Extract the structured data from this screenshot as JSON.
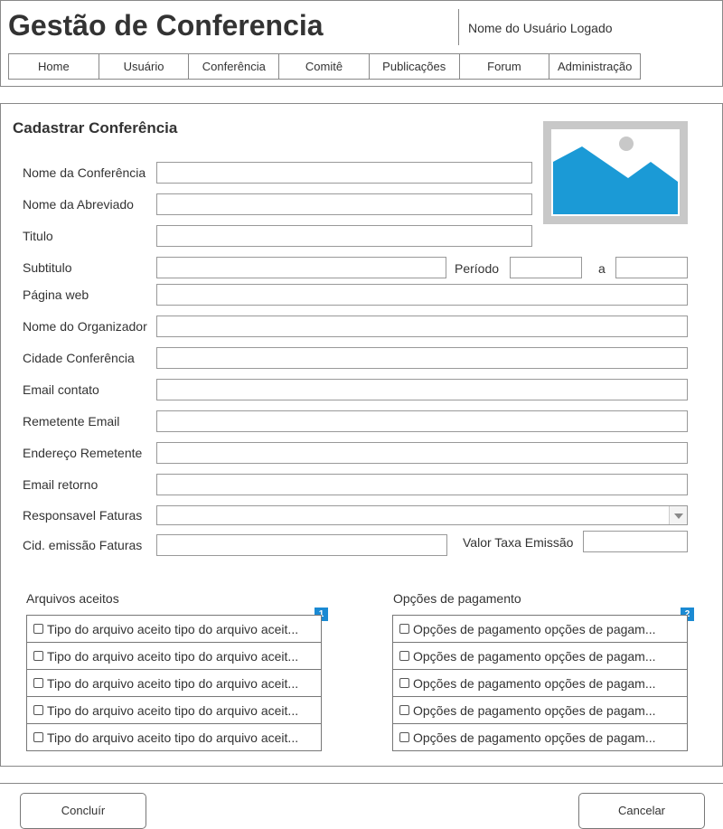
{
  "header": {
    "title": "Gestão de Conferencia",
    "user_name": "Nome do Usuário Logado",
    "nav": [
      "Home",
      "Usuário",
      "Conferência",
      "Comitê",
      "Publicações",
      "Forum",
      "Administração"
    ]
  },
  "form": {
    "title": "Cadastrar Conferência",
    "labels": {
      "nome_conferencia": "Nome da Conferência",
      "nome_abreviado": "Nome da Abreviado",
      "titulo": "Titulo",
      "subtitulo": "Subtitulo",
      "periodo": "Período",
      "periodo_a": "a",
      "pagina_web": "Página web",
      "nome_organizador": "Nome do Organizador",
      "cidade_conferencia": "Cidade Conferência",
      "email_contato": "Email contato",
      "remetente_email": "Remetente Email",
      "endereco_remetente": "Endereço Remetente",
      "email_retorno": "Email retorno",
      "responsavel_faturas": "Responsavel Faturas",
      "cid_emissao_faturas": "Cid. emissão Faturas",
      "valor_taxa_emissao": "Valor Taxa Emissão"
    },
    "values": {
      "nome_conferencia": "",
      "nome_abreviado": "",
      "titulo": "",
      "subtitulo": "",
      "periodo_inicio": "",
      "periodo_fim": "",
      "pagina_web": "",
      "nome_organizador": "",
      "cidade_conferencia": "",
      "email_contato": "",
      "remetente_email": "",
      "endereco_remetente": "",
      "email_retorno": "",
      "responsavel_faturas": "",
      "cid_emissao_faturas": "",
      "valor_taxa_emissao": ""
    }
  },
  "arquivos": {
    "title": "Arquivos aceitos",
    "badge": "1",
    "items": [
      "Tipo do arquivo aceito tipo do arquivo aceit...",
      "Tipo do arquivo aceito tipo do arquivo aceit...",
      "Tipo do arquivo aceito tipo do arquivo aceit...",
      "Tipo do arquivo aceito tipo do arquivo aceit...",
      "Tipo do arquivo aceito tipo do arquivo aceit..."
    ]
  },
  "pagamento": {
    "title": "Opções de pagamento",
    "badge": "2",
    "items": [
      "Opções de pagamento opções de pagam...",
      "Opções de pagamento opções de pagam...",
      "Opções de pagamento opções de pagam...",
      "Opções de pagamento opções de pagam...",
      "Opções de pagamento opções de pagam..."
    ]
  },
  "actions": {
    "concluir": "Concluír",
    "cancelar": "Cancelar"
  },
  "colors": {
    "accent": "#1b8ad3",
    "image_frame": "#c8c8c8",
    "image_sky": "#1b9ad6",
    "image_sun": "#c8c8c8"
  },
  "icons": {
    "image_placeholder": "image-placeholder-icon",
    "dropdown": "chevron-down-icon",
    "checkbox": "checkbox-icon"
  }
}
